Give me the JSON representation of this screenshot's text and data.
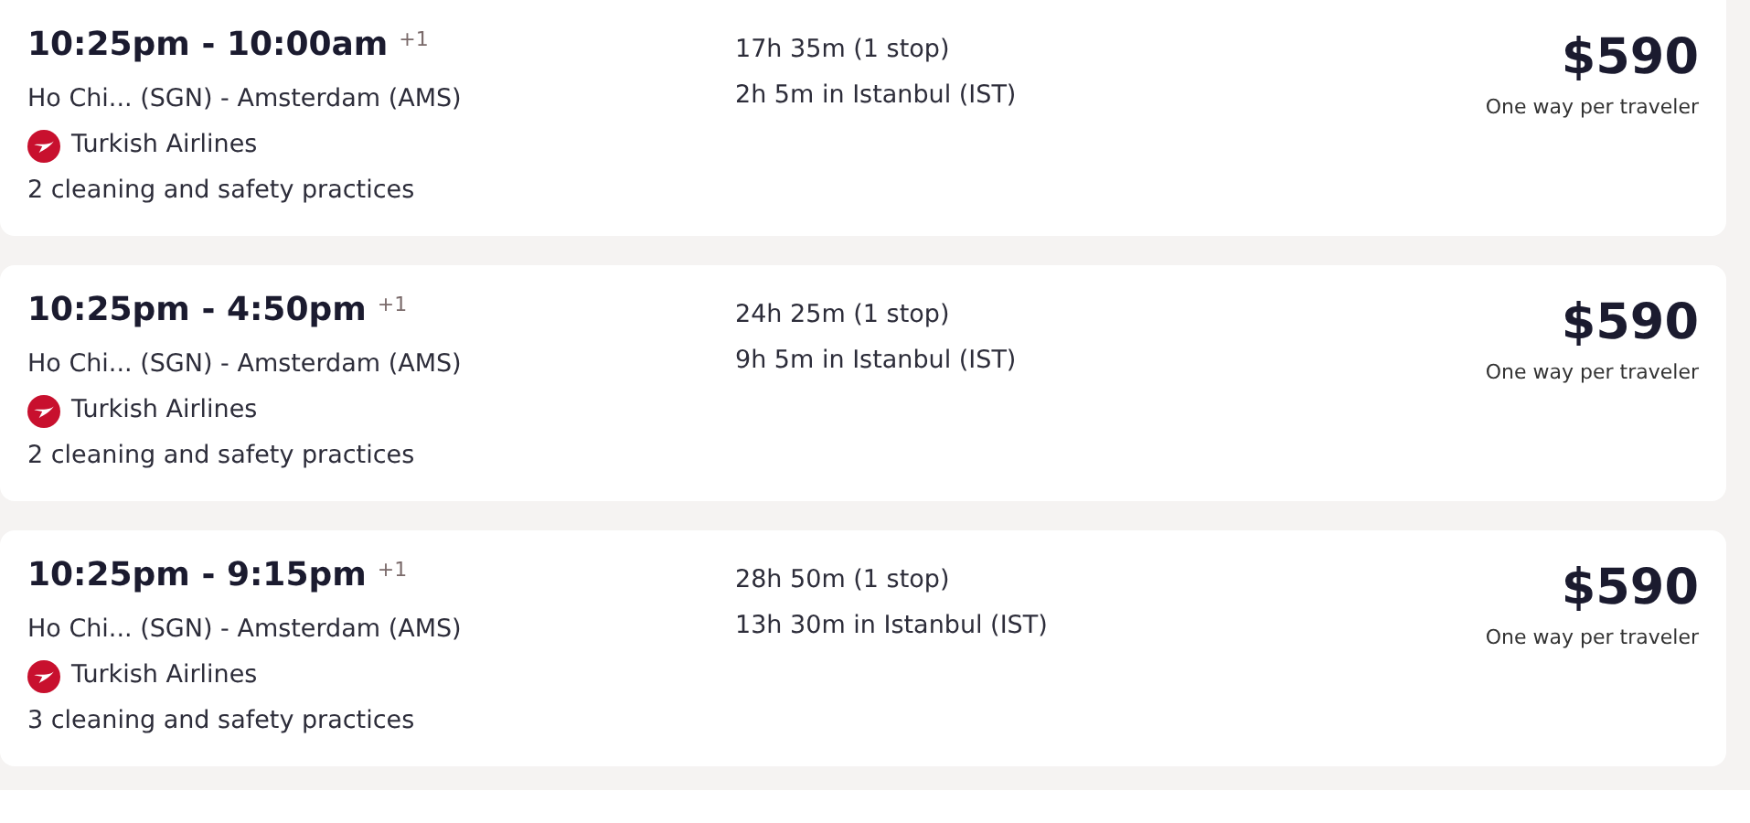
{
  "flights": [
    {
      "times": "10:25pm - 10:00am",
      "day_offset": "+1",
      "route": "Ho Chi... (SGN) - Amsterdam (AMS)",
      "airline": "Turkish Airlines",
      "practices": "2 cleaning and safety practices",
      "duration": "17h 35m (1 stop)",
      "layover": "2h 5m in Istanbul (IST)",
      "price": "$590",
      "price_note": "One way per traveler"
    },
    {
      "times": "10:25pm - 4:50pm",
      "day_offset": "+1",
      "route": "Ho Chi... (SGN) - Amsterdam (AMS)",
      "airline": "Turkish Airlines",
      "practices": "2 cleaning and safety practices",
      "duration": "24h 25m (1 stop)",
      "layover": "9h 5m in Istanbul (IST)",
      "price": "$590",
      "price_note": "One way per traveler"
    },
    {
      "times": "10:25pm - 9:15pm",
      "day_offset": "+1",
      "route": "Ho Chi... (SGN) - Amsterdam (AMS)",
      "airline": "Turkish Airlines",
      "practices": "3 cleaning and safety practices",
      "duration": "28h 50m (1 stop)",
      "layover": "13h 30m in Istanbul (IST)",
      "price": "$590",
      "price_note": "One way per traveler"
    }
  ]
}
